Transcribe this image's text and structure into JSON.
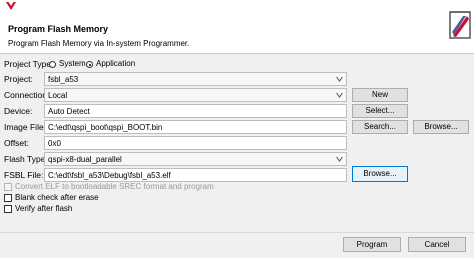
{
  "header": {
    "title": "Program Flash Memory",
    "subtitle": "Program Flash Memory via In-system Programmer."
  },
  "project_type": {
    "label": "Project Type:",
    "options": [
      "System",
      "Application"
    ],
    "selected": "Application"
  },
  "project": {
    "label": "Project:",
    "value": "fsbl_a53"
  },
  "connection": {
    "label": "Connection:",
    "value": "Local",
    "new_button": "New"
  },
  "device": {
    "label": "Device:",
    "value": "Auto Detect",
    "select_button": "Select..."
  },
  "image_file": {
    "label": "Image File:",
    "value": "C:\\edt\\qspi_boot\\qspi_BOOT.bin",
    "search_button": "Search...",
    "browse_button": "Browse..."
  },
  "offset": {
    "label": "Offset:",
    "value": "0x0"
  },
  "flash_type": {
    "label": "Flash Type",
    "value": "qspi-x8-dual_parallel"
  },
  "fsbl_file": {
    "label": "FSBL File:",
    "value": "C:\\edt\\fsbl_a53\\Debug\\fsbl_a53.elf",
    "browse_button": "Browse..."
  },
  "options": {
    "convert_elf": "Convert ELF to bootloadable SREC format and program",
    "blank_check": "Blank check after erase",
    "verify": "Verify after flash"
  },
  "footer": {
    "program_button": "Program",
    "cancel_button": "Cancel"
  },
  "colors": {
    "accent": "#0078d7",
    "logo_red": "#c8102e"
  }
}
